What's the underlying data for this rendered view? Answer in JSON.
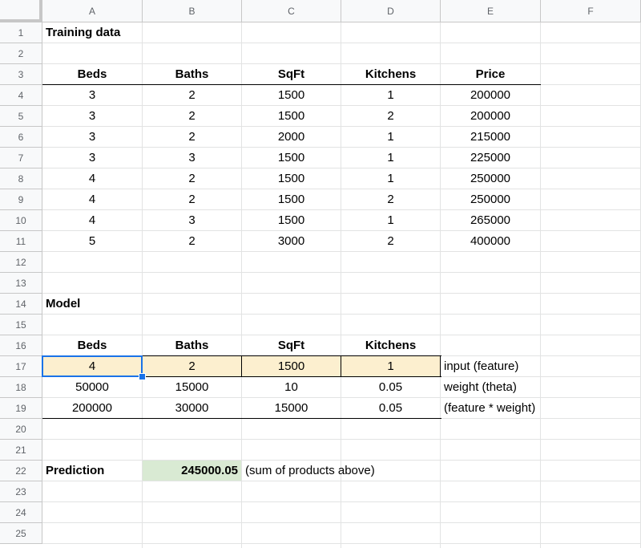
{
  "columns": [
    "A",
    "B",
    "C",
    "D",
    "E",
    "F"
  ],
  "rows": [
    "1",
    "2",
    "3",
    "4",
    "5",
    "6",
    "7",
    "8",
    "9",
    "10",
    "11",
    "12",
    "13",
    "14",
    "15",
    "16",
    "17",
    "18",
    "19",
    "20",
    "21",
    "22",
    "23",
    "24",
    "25"
  ],
  "training": {
    "title": "Training data",
    "headers": [
      "Beds",
      "Baths",
      "SqFt",
      "Kitchens",
      "Price"
    ],
    "rows": [
      [
        "3",
        "2",
        "1500",
        "1",
        "200000"
      ],
      [
        "3",
        "2",
        "1500",
        "2",
        "200000"
      ],
      [
        "3",
        "2",
        "2000",
        "1",
        "215000"
      ],
      [
        "3",
        "3",
        "1500",
        "1",
        "225000"
      ],
      [
        "4",
        "2",
        "1500",
        "1",
        "250000"
      ],
      [
        "4",
        "2",
        "1500",
        "2",
        "250000"
      ],
      [
        "4",
        "3",
        "1500",
        "1",
        "265000"
      ],
      [
        "5",
        "2",
        "3000",
        "2",
        "400000"
      ]
    ]
  },
  "model": {
    "title": "Model",
    "headers": [
      "Beds",
      "Baths",
      "SqFt",
      "Kitchens"
    ],
    "input": [
      "4",
      "2",
      "1500",
      "1"
    ],
    "input_label": "input (feature)",
    "weights": [
      "50000",
      "15000",
      "10",
      "0.05"
    ],
    "weights_label": "weight (theta)",
    "products": [
      "200000",
      "30000",
      "15000",
      "0.05"
    ],
    "products_label": "(feature * weight)"
  },
  "prediction": {
    "label": "Prediction",
    "value": "245000.05",
    "note": "(sum of products above)"
  },
  "colors": {
    "input_fill": "#fcefcf",
    "prediction_fill": "#d9ead3",
    "selection": "#1a73e8",
    "header_bg": "#f8f9fa"
  }
}
